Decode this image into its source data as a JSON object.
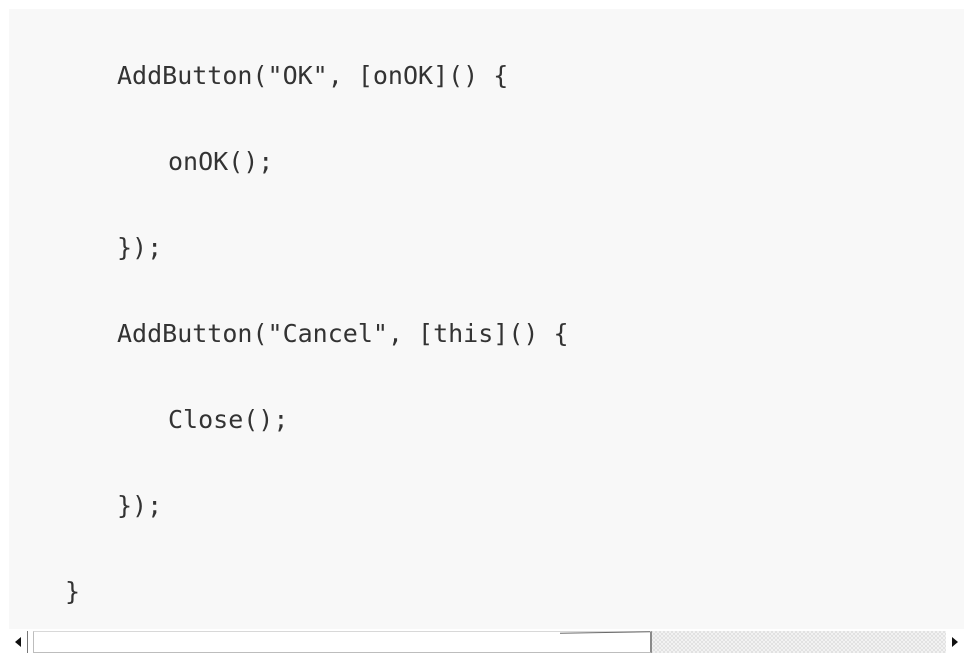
{
  "code": {
    "lines": [
      "AddButton(\"OK\", [onOK]() {",
      "onOK();",
      "});",
      "AddButton(\"Cancel\", [this]() {",
      "Close();",
      "});",
      "}"
    ]
  },
  "scrollbar": {
    "left_arrow_icon": "triangle-left-icon",
    "right_arrow_icon": "triangle-right-icon"
  },
  "colors": {
    "panel_background": "#f8f8f8",
    "code_text": "#333333"
  }
}
